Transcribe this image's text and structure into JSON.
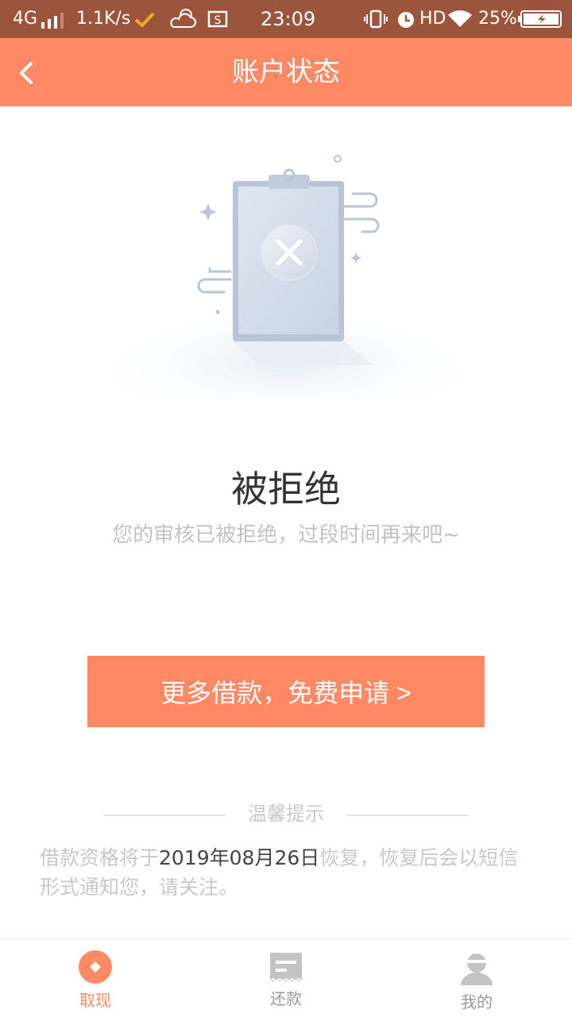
{
  "statusbar": {
    "network": "4G",
    "speed": "1.1K/s",
    "time": "23:09",
    "hd": "HD",
    "battery": "25%"
  },
  "header": {
    "title": "账户状态",
    "back_icon": "chevron-left-icon"
  },
  "status": {
    "icon": "rejected-clipboard-illustration",
    "title": "被拒绝",
    "subtitle": "您的审核已被拒绝，过段时间再来吧~"
  },
  "cta": {
    "label": "更多借款，免费申请 >"
  },
  "tips": {
    "title": "温馨提示",
    "text_before": "借款资格将于",
    "date": "2019年08月26日",
    "text_after": "恢复，恢复后会以短信形式通知您，请关注。"
  },
  "tabs": [
    {
      "label": "取现",
      "icon": "withdraw-icon",
      "active": true
    },
    {
      "label": "还款",
      "icon": "repay-icon",
      "active": false
    },
    {
      "label": "我的",
      "icon": "profile-icon",
      "active": false
    }
  ],
  "colors": {
    "statusbar": "#9c553d",
    "accent": "#ff8964",
    "muted_text": "#c2c2c2"
  }
}
